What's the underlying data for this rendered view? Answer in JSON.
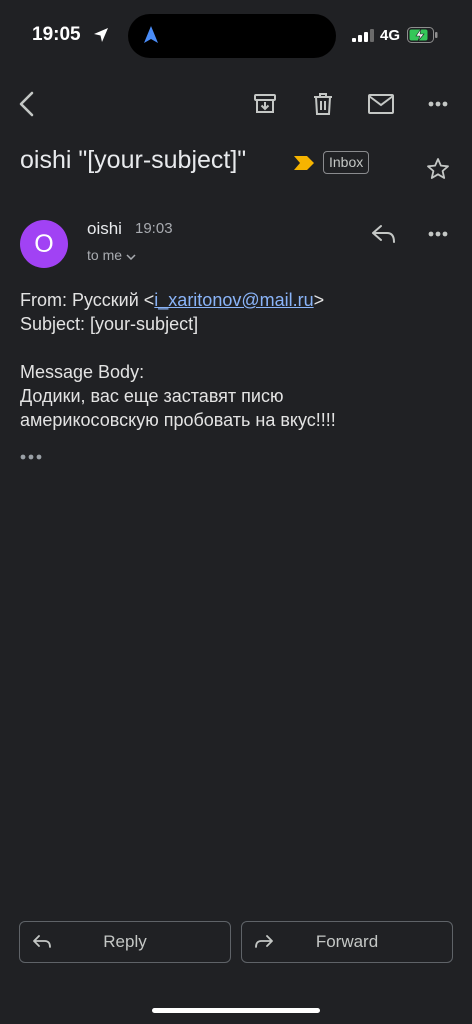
{
  "status_bar": {
    "time": "19:05",
    "network": "4G"
  },
  "toolbar": {
    "back_icon": "back-arrow-icon",
    "actions": [
      "archive-icon",
      "delete-icon",
      "mark-unread-icon",
      "more-icon"
    ]
  },
  "subject": {
    "text": "oishi \"[your-subject]\"",
    "label": "Inbox",
    "importance_color": "#f6b400"
  },
  "sender": {
    "initial": "O",
    "name": "oishi",
    "time": "19:03",
    "recipient": "to me",
    "avatar_color": "#a142f4"
  },
  "body": {
    "from_prefix": "From: Русский <",
    "from_email": "i_xaritonov@mail.ru",
    "from_suffix": ">",
    "subject_line": "Subject: [your-subject]",
    "body_heading": "Message Body:",
    "body_line1": "Додики, вас еще заставят писю",
    "body_line2": "америкосовскую пробовать на вкус!!!!"
  },
  "actions": {
    "reply_label": "Reply",
    "forward_label": "Forward"
  }
}
